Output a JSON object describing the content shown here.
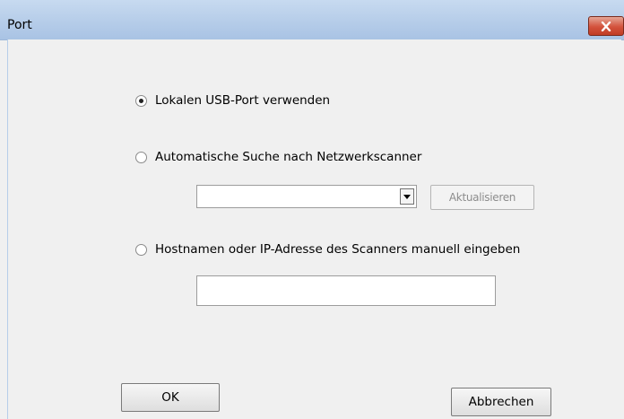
{
  "window": {
    "title": "Port",
    "close_icon": "close-icon"
  },
  "options": {
    "usb_label": "Lokalen USB-Port verwenden",
    "usb_selected": true,
    "network_label": "Automatische Suche nach Netzwerkscanner",
    "network_selected": false,
    "manual_label": "Hostnamen oder IP-Adresse des Scanners manuell eingeben",
    "manual_selected": false
  },
  "scanner_dropdown": {
    "selected_value": ""
  },
  "refresh_button": {
    "label": "Aktualisieren",
    "enabled": false
  },
  "host_input": {
    "value": ""
  },
  "buttons": {
    "ok": "OK",
    "cancel": "Abbrechen"
  }
}
